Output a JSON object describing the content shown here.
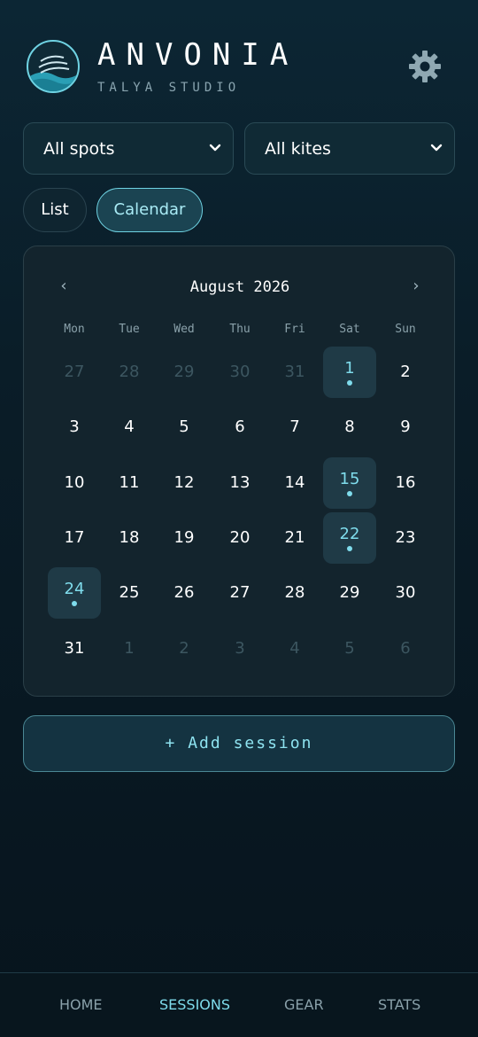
{
  "brand": {
    "name": "ANVONIA",
    "subtitle": "TALYA STUDIO"
  },
  "filters": {
    "spot": "All spots",
    "kite": "All kites"
  },
  "view_toggle": {
    "list": "List",
    "calendar": "Calendar",
    "active": "calendar"
  },
  "calendar": {
    "title": "August 2026",
    "prev": "‹",
    "next": "›",
    "weekdays": [
      "Mon",
      "Tue",
      "Wed",
      "Thu",
      "Fri",
      "Sat",
      "Sun"
    ],
    "weeks": [
      [
        {
          "d": "27",
          "m": true
        },
        {
          "d": "28",
          "m": true
        },
        {
          "d": "29",
          "m": true
        },
        {
          "d": "30",
          "m": true
        },
        {
          "d": "31",
          "m": true
        },
        {
          "d": "1",
          "s": true
        },
        {
          "d": "2"
        }
      ],
      [
        {
          "d": "3"
        },
        {
          "d": "4"
        },
        {
          "d": "5"
        },
        {
          "d": "6"
        },
        {
          "d": "7"
        },
        {
          "d": "8"
        },
        {
          "d": "9"
        }
      ],
      [
        {
          "d": "10"
        },
        {
          "d": "11"
        },
        {
          "d": "12"
        },
        {
          "d": "13"
        },
        {
          "d": "14"
        },
        {
          "d": "15",
          "s": true
        },
        {
          "d": "16"
        }
      ],
      [
        {
          "d": "17"
        },
        {
          "d": "18"
        },
        {
          "d": "19"
        },
        {
          "d": "20"
        },
        {
          "d": "21"
        },
        {
          "d": "22",
          "s": true
        },
        {
          "d": "23"
        }
      ],
      [
        {
          "d": "24",
          "s": true
        },
        {
          "d": "25"
        },
        {
          "d": "26"
        },
        {
          "d": "27"
        },
        {
          "d": "28"
        },
        {
          "d": "29"
        },
        {
          "d": "30"
        }
      ],
      [
        {
          "d": "31"
        },
        {
          "d": "1",
          "m": true
        },
        {
          "d": "2",
          "m": true
        },
        {
          "d": "3",
          "m": true
        },
        {
          "d": "4",
          "m": true
        },
        {
          "d": "5",
          "m": true
        },
        {
          "d": "6",
          "m": true
        }
      ]
    ]
  },
  "add_session": "+ Add session",
  "nav": {
    "items": [
      "HOME",
      "SESSIONS",
      "GEAR",
      "STATS"
    ],
    "active": "SESSIONS"
  },
  "colors": {
    "accent": "#7fdcec",
    "background": "#0a1d28"
  }
}
